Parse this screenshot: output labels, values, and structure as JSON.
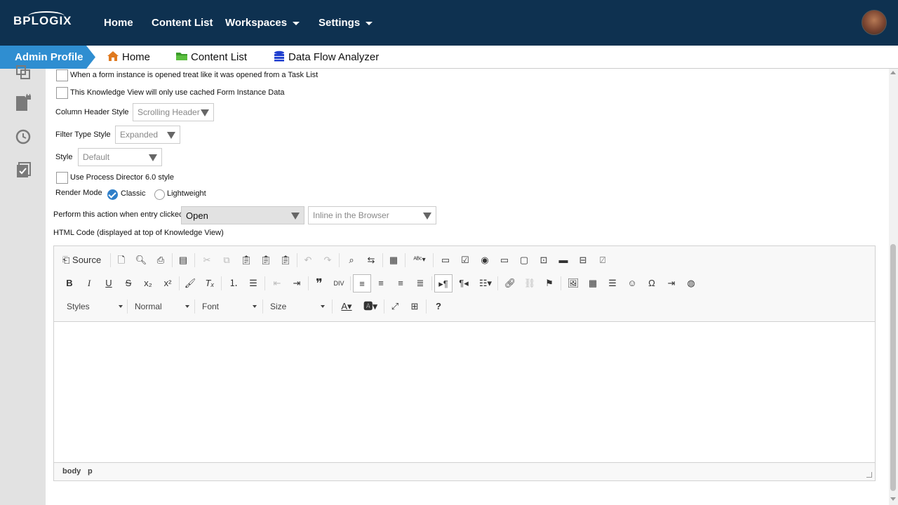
{
  "topnav": {
    "logo": "BPLOGIX",
    "items": [
      {
        "label": "Home"
      },
      {
        "label": "Content List"
      },
      {
        "label": "Workspaces"
      },
      {
        "label": "Settings"
      }
    ]
  },
  "tabs": {
    "active": "Admin Profile",
    "items": [
      {
        "label": "Home",
        "icon": "home-icon",
        "color": "#e07a1f"
      },
      {
        "label": "Content List",
        "icon": "folder-icon",
        "color": "#3a9a2a"
      },
      {
        "label": "Data Flow Analyzer",
        "icon": "database-icon",
        "color": "#1f3fcf"
      }
    ]
  },
  "sidebar": {
    "icons": [
      "copy-icon",
      "locked-document-icon",
      "refresh-icon",
      "checklist-icon"
    ]
  },
  "form": {
    "cb_task_list": "When a form instance is opened treat like it was opened from a Task List",
    "cb_cached": "This Knowledge View will only use cached Form Instance Data",
    "column_header_label": "Column Header Style",
    "column_header_value": "Scrolling Header",
    "filter_type_label": "Filter Type Style",
    "filter_type_value": "Expanded",
    "style_label": "Style",
    "style_value": "Default",
    "cb_pd6": "Use Process Director 6.0 style",
    "render_mode_label": "Render Mode",
    "render_classic": "Classic",
    "render_lightweight": "Lightweight",
    "action_label": "Perform this action when entry clicked",
    "action_value": "Open",
    "action_target_value": "Inline in the Browser",
    "html_code_label": "HTML Code (displayed at top of Knowledge View)"
  },
  "editor": {
    "source_label": "Source",
    "styles": "Styles",
    "format": "Normal",
    "font": "Font",
    "size": "Size",
    "path": [
      "body",
      "p"
    ]
  },
  "colors": {
    "nav_bg": "#0e3150",
    "admin_tab": "#2f8ed1",
    "sidebar_bg": "#e2e2e2"
  }
}
